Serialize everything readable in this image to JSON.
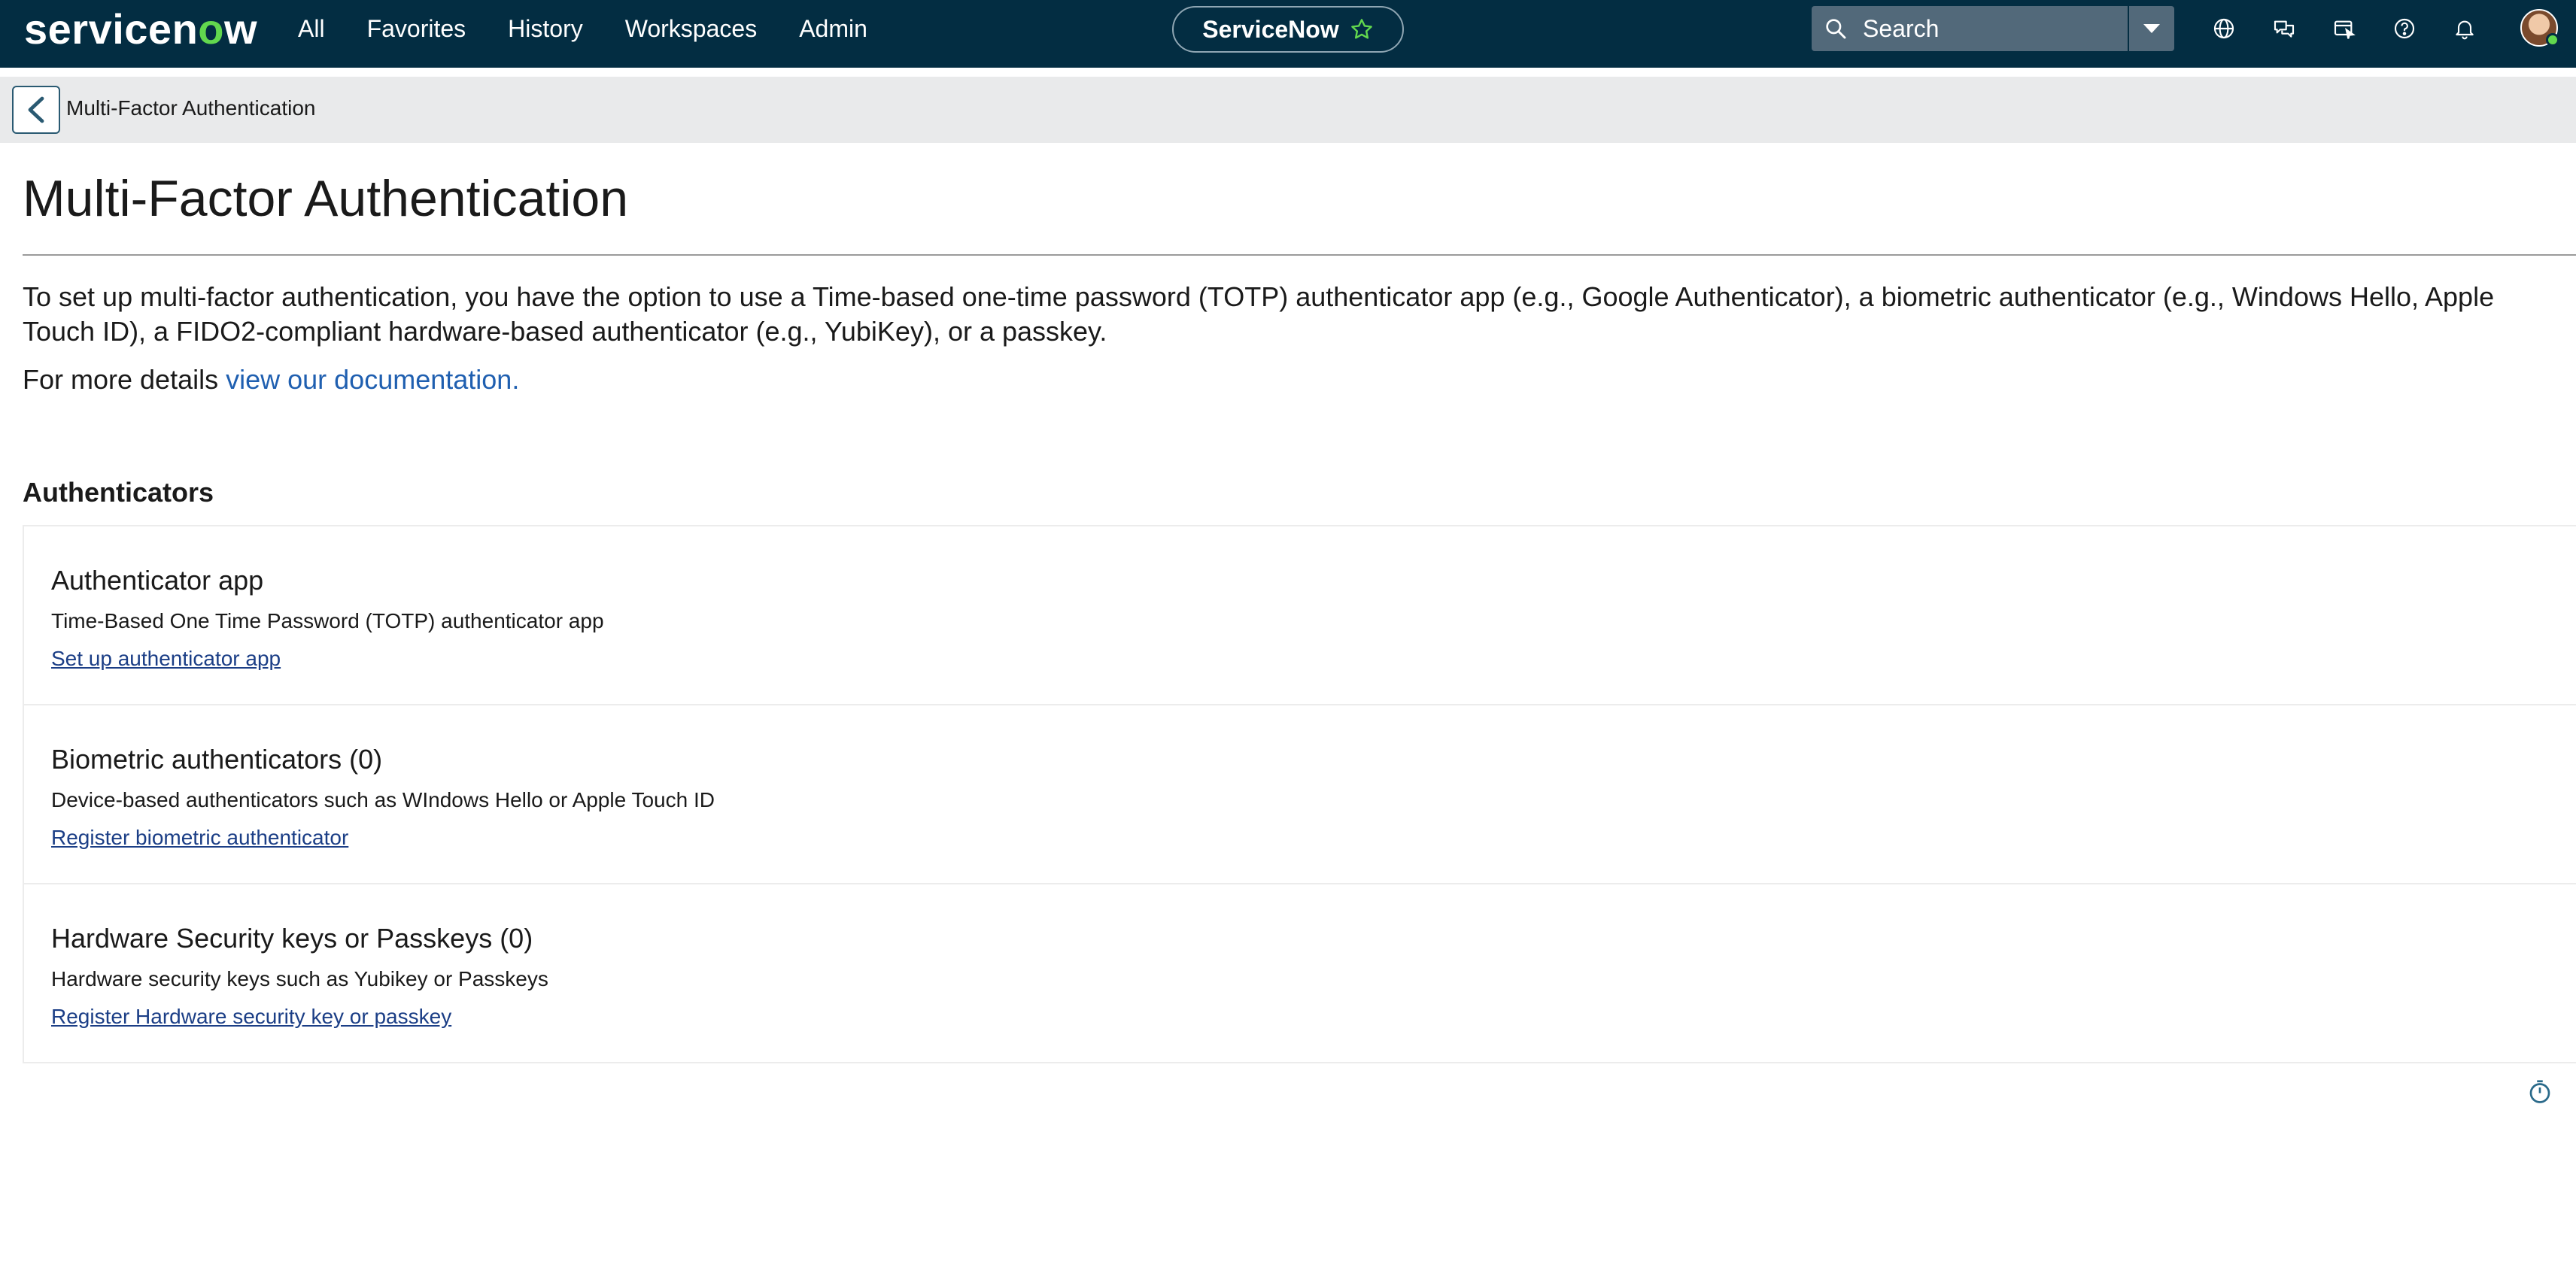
{
  "brand": {
    "logo_text_before": "servicen",
    "logo_text_o": "o",
    "logo_text_after": "w",
    "accent_color": "#62d84e",
    "navbar_color": "#032d42"
  },
  "nav": {
    "items": [
      {
        "label": "All"
      },
      {
        "label": "Favorites"
      },
      {
        "label": "History"
      },
      {
        "label": "Workspaces"
      },
      {
        "label": "Admin"
      }
    ],
    "instance_label": "ServiceNow",
    "search_placeholder": "Search",
    "icons": [
      "globe-icon",
      "chat-icon",
      "screen-capture-icon",
      "help-icon",
      "bell-icon"
    ]
  },
  "breadcrumb": {
    "title": "Multi-Factor Authentication"
  },
  "page": {
    "title": "Multi-Factor Authentication",
    "intro": "To set up multi-factor authentication, you have the option to use a Time-based one-time password (TOTP) authenticator app (e.g., Google Authenticator), a biometric authenticator (e.g., Windows Hello, Apple Touch ID), a FIDO2-compliant hardware-based authenticator (e.g., YubiKey), or a passkey.",
    "details_prefix": "For more details",
    "details_link": "view our documentation.",
    "section_heading": "Authenticators"
  },
  "authenticators": [
    {
      "title": "Authenticator app",
      "description": "Time-Based One Time Password (TOTP) authenticator app",
      "link": "Set up authenticator app"
    },
    {
      "title": "Biometric authenticators (0)",
      "description": "Device-based authenticators such as WIndows Hello or Apple Touch ID",
      "link": "Register biometric authenticator"
    },
    {
      "title": "Hardware Security keys or Passkeys (0)",
      "description": "Hardware security keys such as Yubikey or Passkeys",
      "link": "Register Hardware security key or passkey"
    }
  ]
}
